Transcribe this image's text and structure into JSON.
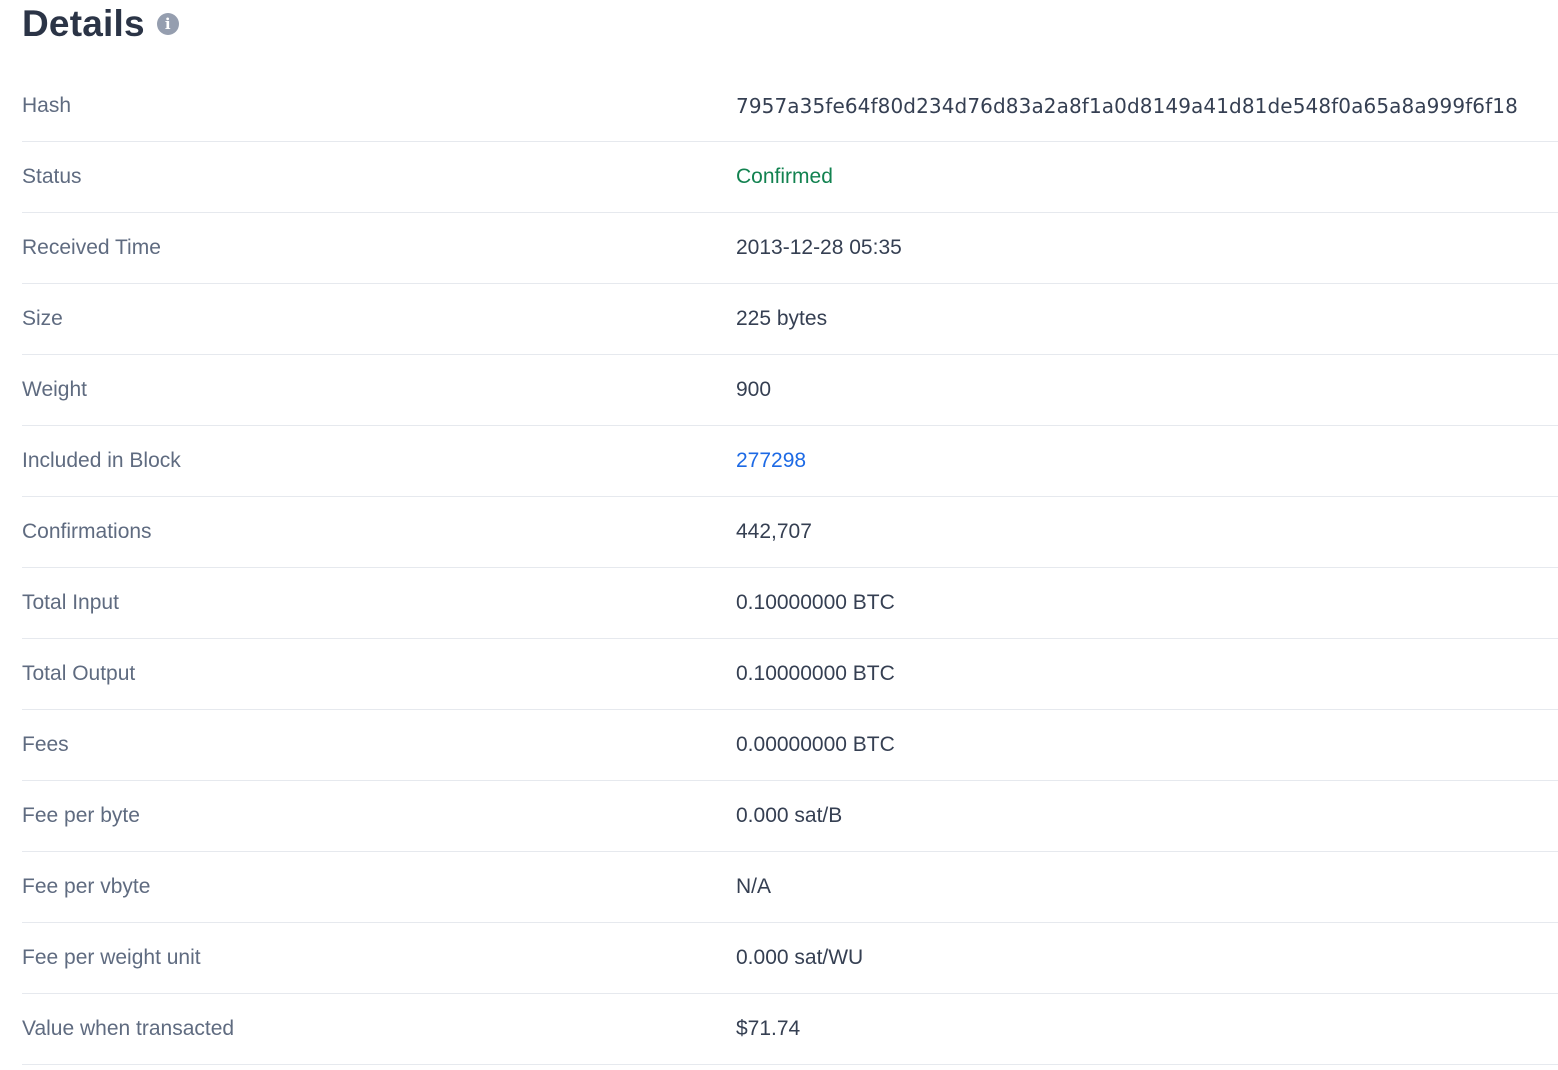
{
  "header": {
    "title": "Details",
    "info_icon": "info-icon"
  },
  "colors": {
    "status_confirmed": "#128250",
    "link": "#1d6ae5",
    "label": "#5f6b80",
    "value": "#353f52"
  },
  "details": {
    "hash": {
      "label": "Hash",
      "value": "7957a35fe64f80d234d76d83a2a8f1a0d8149a41d81de548f0a65a8a999f6f18"
    },
    "status": {
      "label": "Status",
      "value": "Confirmed"
    },
    "received_time": {
      "label": "Received Time",
      "value": "2013-12-28 05:35"
    },
    "size": {
      "label": "Size",
      "value": "225 bytes"
    },
    "weight": {
      "label": "Weight",
      "value": "900"
    },
    "included_in_block": {
      "label": "Included in Block",
      "value": "277298"
    },
    "confirmations": {
      "label": "Confirmations",
      "value": "442,707"
    },
    "total_input": {
      "label": "Total Input",
      "value": "0.10000000 BTC"
    },
    "total_output": {
      "label": "Total Output",
      "value": "0.10000000 BTC"
    },
    "fees": {
      "label": "Fees",
      "value": "0.00000000 BTC"
    },
    "fee_per_byte": {
      "label": "Fee per byte",
      "value": "0.000 sat/B"
    },
    "fee_per_vbyte": {
      "label": "Fee per vbyte",
      "value": "N/A"
    },
    "fee_per_weight_unit": {
      "label": "Fee per weight unit",
      "value": "0.000 sat/WU"
    },
    "value_when_transacted": {
      "label": "Value when transacted",
      "value": "$71.74"
    }
  }
}
